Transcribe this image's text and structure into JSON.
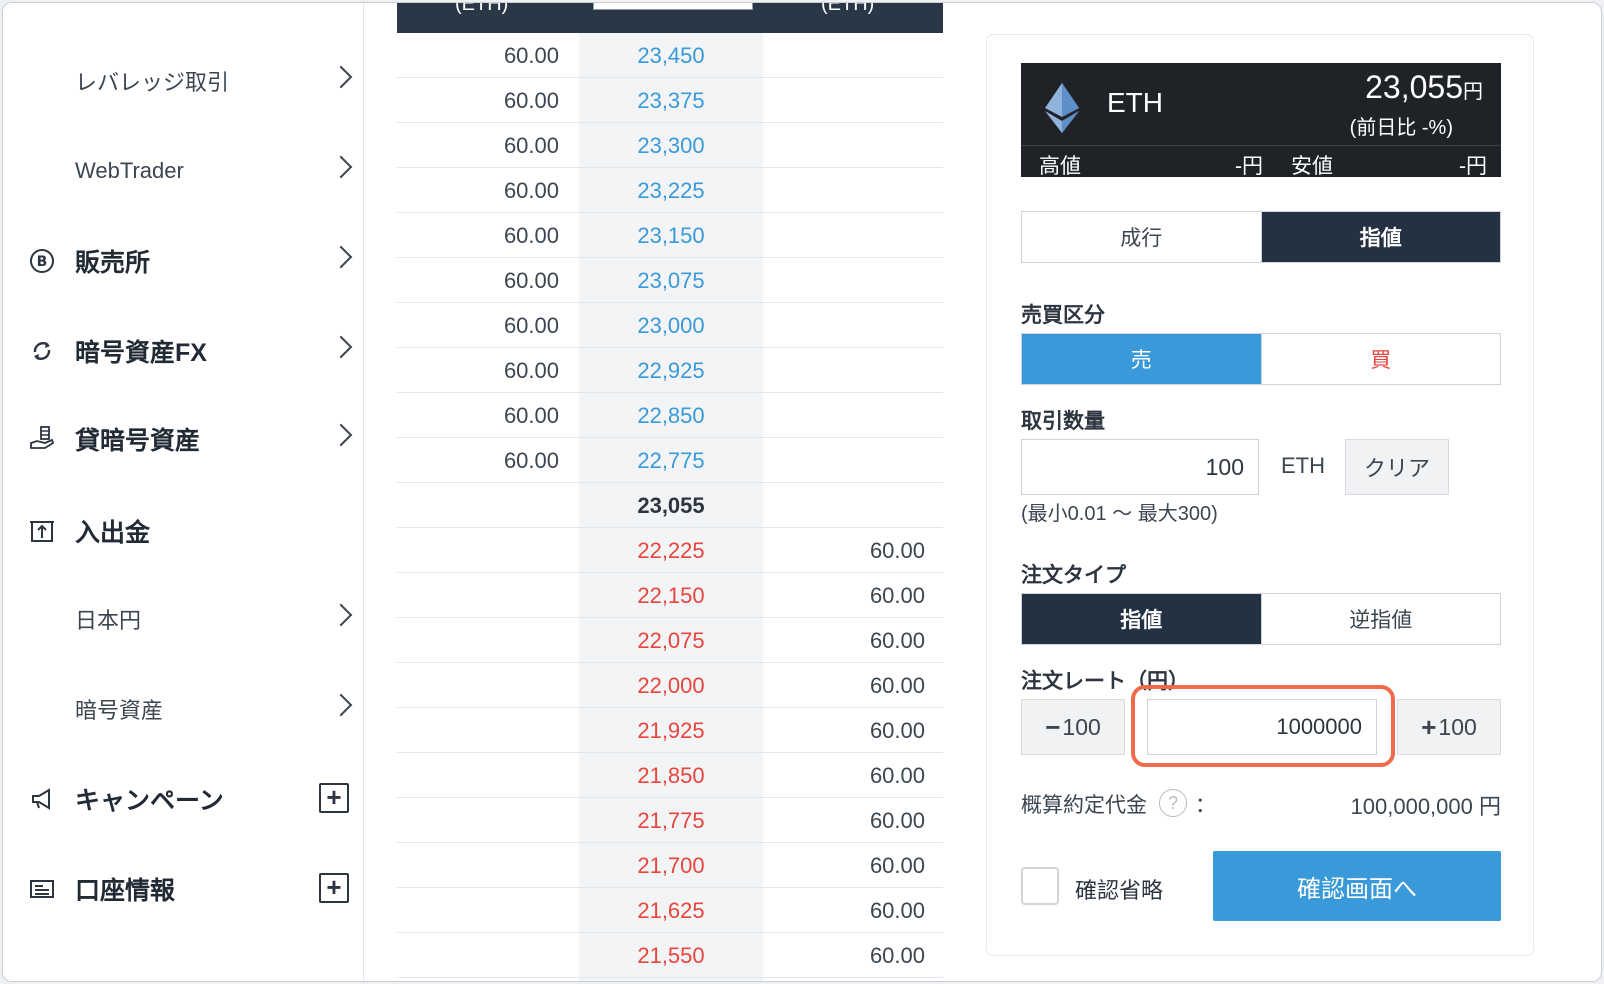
{
  "sidebar": {
    "items": [
      {
        "label": "レバレッジ取引",
        "icon": null,
        "action": "chevron"
      },
      {
        "label": "WebTrader",
        "icon": null,
        "action": "chevron"
      },
      {
        "label": "販売所",
        "icon": "bitcoin-circle-icon",
        "action": "chevron"
      },
      {
        "label": "暗号資産FX",
        "icon": "exchange-arrows-icon",
        "action": "chevron"
      },
      {
        "label": "貸暗号資産",
        "icon": "coin-hand-icon",
        "action": "chevron"
      },
      {
        "label": "入出金",
        "icon": "deposit-box-icon",
        "action": "none"
      },
      {
        "label": "日本円",
        "icon": null,
        "action": "chevron"
      },
      {
        "label": "暗号資産",
        "icon": null,
        "action": "chevron"
      },
      {
        "label": "キャンペーン",
        "icon": "megaphone-icon",
        "action": "plus"
      },
      {
        "label": "口座情報",
        "icon": "id-card-icon",
        "action": "plus"
      }
    ]
  },
  "orderbook": {
    "header": {
      "col1": "(ETH)",
      "col3": "(ETH)"
    },
    "asks": [
      {
        "qty": "60.00",
        "price": "23,450"
      },
      {
        "qty": "60.00",
        "price": "23,375"
      },
      {
        "qty": "60.00",
        "price": "23,300"
      },
      {
        "qty": "60.00",
        "price": "23,225"
      },
      {
        "qty": "60.00",
        "price": "23,150"
      },
      {
        "qty": "60.00",
        "price": "23,075"
      },
      {
        "qty": "60.00",
        "price": "23,000"
      },
      {
        "qty": "60.00",
        "price": "22,925"
      },
      {
        "qty": "60.00",
        "price": "22,850"
      },
      {
        "qty": "60.00",
        "price": "22,775"
      }
    ],
    "mid": "23,055",
    "bids": [
      {
        "qty": "60.00",
        "price": "22,225"
      },
      {
        "qty": "60.00",
        "price": "22,150"
      },
      {
        "qty": "60.00",
        "price": "22,075"
      },
      {
        "qty": "60.00",
        "price": "22,000"
      },
      {
        "qty": "60.00",
        "price": "21,925"
      },
      {
        "qty": "60.00",
        "price": "21,850"
      },
      {
        "qty": "60.00",
        "price": "21,775"
      },
      {
        "qty": "60.00",
        "price": "21,700"
      },
      {
        "qty": "60.00",
        "price": "21,625"
      },
      {
        "qty": "60.00",
        "price": "21,550"
      }
    ]
  },
  "ticker": {
    "symbol": "ETH",
    "price": "23,055",
    "price_unit": "円",
    "change": "(前日比 -%)",
    "high_label": "高値",
    "high_value": "-円",
    "low_label": "安値",
    "low_value": "-円"
  },
  "order": {
    "type_tabs": [
      "成行",
      "指値"
    ],
    "side_label": "売買区分",
    "side_tabs": [
      "売",
      "買"
    ],
    "qty_label": "取引数量",
    "qty_value": "100",
    "qty_unit": "ETH",
    "clear_label": "クリア",
    "qty_hint": "(最小0.01 〜 最大300)",
    "order_type_label": "注文タイプ",
    "order_type_tabs": [
      "指値",
      "逆指値"
    ],
    "rate_label": "注文レート（円）",
    "rate_minus": "100",
    "rate_plus": "100",
    "rate_value": "1000000",
    "est_label": "概算約定代金",
    "est_help": "?",
    "est_colon": "：",
    "est_value": "100,000,000 円",
    "skip_confirm_label": "確認省略",
    "confirm_button": "確認画面へ"
  },
  "colors": {
    "ask": "#3a9ad9",
    "bid": "#e8453c",
    "dark": "#243142",
    "highlight": "#f06a4b"
  }
}
